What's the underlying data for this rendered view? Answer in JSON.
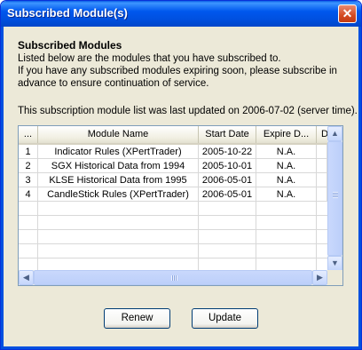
{
  "window": {
    "title": "Subscribed Module(s)"
  },
  "heading": "Subscribed Modules",
  "description": [
    "Listed below are the modules that you have subscribed to.",
    "If you have any subscribed modules expiring soon, please subscribe in",
    "advance to ensure continuation of service."
  ],
  "last_updated": "This subscription module list was last updated on 2006-07-02 (server time).",
  "table": {
    "columns": [
      "...",
      "Module Name",
      "Start Date",
      "Expire D...",
      "D"
    ],
    "rows": [
      [
        "1",
        "Indicator Rules (XPertTrader)",
        "2005-10-22",
        "N.A."
      ],
      [
        "2",
        "SGX Historical Data from 1994",
        "2005-10-01",
        "N.A."
      ],
      [
        "3",
        "KLSE Historical Data from 1995",
        "2006-05-01",
        "N.A."
      ],
      [
        "4",
        "CandleStick Rules (XPertTrader)",
        "2006-05-01",
        "N.A."
      ]
    ]
  },
  "buttons": {
    "renew": "Renew",
    "update": "Update"
  }
}
